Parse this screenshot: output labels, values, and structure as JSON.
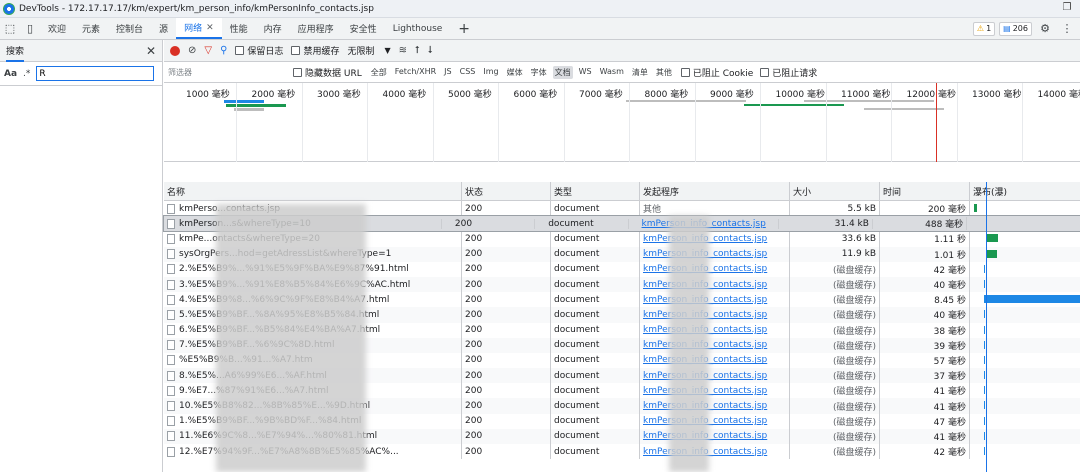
{
  "window": {
    "title": "DevTools - 172.17.17.17/km/expert/km_person_info/kmPersonInfo_contacts.jsp"
  },
  "tabs": [
    {
      "label": "欢迎"
    },
    {
      "label": "元素"
    },
    {
      "label": "控制台"
    },
    {
      "label": "源"
    },
    {
      "label": "网络",
      "active": true
    },
    {
      "label": "性能"
    },
    {
      "label": "内存"
    },
    {
      "label": "应用程序"
    },
    {
      "label": "安全性"
    },
    {
      "label": "Lighthouse"
    }
  ],
  "status_badges": {
    "warnings": "1",
    "issues": "206"
  },
  "sidebar": {
    "title": "搜索",
    "case_label": "Aa",
    "regex_label": ".*",
    "search_value": "R"
  },
  "toolbar": {
    "preserve_log": "保留日志",
    "disable_cache": "禁用缓存",
    "throttle": "无限制"
  },
  "filterbar": {
    "placeholder": "筛选器",
    "hide_data_urls": "隐藏数据 URL",
    "types": [
      "全部",
      "Fetch/XHR",
      "JS",
      "CSS",
      "Img",
      "媒体",
      "字体",
      "文档",
      "WS",
      "Wasm",
      "清单",
      "其他"
    ],
    "active_type": "文档",
    "blocked_cookies": "已阻止 Cookie",
    "blocked_requests": "已阻止请求"
  },
  "overview_ticks": [
    "1000 毫秒",
    "2000 毫秒",
    "3000 毫秒",
    "4000 毫秒",
    "5000 毫秒",
    "6000 毫秒",
    "7000 毫秒",
    "8000 毫秒",
    "9000 毫秒",
    "10000 毫秒",
    "11000 毫秒",
    "12000 毫秒",
    "13000 毫秒",
    "14000 毫秒"
  ],
  "columns": {
    "name": "名称",
    "status": "状态",
    "type": "类型",
    "initiator": "发起程序",
    "size": "大小",
    "time": "时间",
    "waterfall": "瀑布(瀑)"
  },
  "rows": [
    {
      "name": "kmPerso...contacts.jsp",
      "status": "200",
      "type": "document",
      "initiator": "其他",
      "size": "5.5 kB",
      "time": "200 毫秒"
    },
    {
      "name": "kmPerson...s&whereType=10",
      "status": "200",
      "type": "document",
      "initiator": "kmPerson_info_contacts.jsp",
      "size": "31.4 kB",
      "time": "488 毫秒"
    },
    {
      "name": "kmPe...ontacts&whereType=20",
      "status": "200",
      "type": "document",
      "initiator": "kmPerson_info_contacts.jsp",
      "size": "33.6 kB",
      "time": "1.11 秒"
    },
    {
      "name": "sysOrgPers...hod=getAdressList&whereType=1",
      "status": "200",
      "type": "document",
      "initiator": "kmPerson_info_contacts.jsp",
      "size": "11.9 kB",
      "time": "1.01 秒"
    },
    {
      "name": "2.%E5%B9%...%91%E5%9F%BA%E9%87%91.html",
      "status": "200",
      "type": "document",
      "initiator": "kmPerson_info_contacts.jsp",
      "size": "(磁盘缓存)",
      "time": "42 毫秒"
    },
    {
      "name": "3.%E5%B9%...%91%E8%B5%84%E6%9C%AC.html",
      "status": "200",
      "type": "document",
      "initiator": "kmPerson_info_contacts.jsp",
      "size": "(磁盘缓存)",
      "time": "40 毫秒"
    },
    {
      "name": "4.%E5%B9%8...%6%9C%9F%E8%B4%A7.html",
      "status": "200",
      "type": "document",
      "initiator": "kmPerson_info_contacts.jsp",
      "size": "(磁盘缓存)",
      "time": "8.45 秒"
    },
    {
      "name": "5.%E5%B9%BF...%8A%95%E8%B5%84.html",
      "status": "200",
      "type": "document",
      "initiator": "kmPerson_info_contacts.jsp",
      "size": "(磁盘缓存)",
      "time": "40 毫秒"
    },
    {
      "name": "6.%E5%B9%BF...%B5%84%E4%BA%A7.html",
      "status": "200",
      "type": "document",
      "initiator": "kmPerson_info_contacts.jsp",
      "size": "(磁盘缓存)",
      "time": "38 毫秒"
    },
    {
      "name": "7.%E5%B9%BF...%6%9C%8D.html",
      "status": "200",
      "type": "document",
      "initiator": "kmPerson_info_contacts.jsp",
      "size": "(磁盘缓存)",
      "time": "39 毫秒"
    },
    {
      "name": "%E5%B9%B...%91...%A7.htm",
      "status": "200",
      "type": "document",
      "initiator": "kmPerson_info_contacts.jsp",
      "size": "(磁盘缓存)",
      "time": "57 毫秒"
    },
    {
      "name": "8.%E5%...A6%99%E6...%AF.html",
      "status": "200",
      "type": "document",
      "initiator": "kmPerson_info_contacts.jsp",
      "size": "(磁盘缓存)",
      "time": "37 毫秒"
    },
    {
      "name": "9.%E7...%87%91%E6...%A7.html",
      "status": "200",
      "type": "document",
      "initiator": "kmPerson_info_contacts.jsp",
      "size": "(磁盘缓存)",
      "time": "41 毫秒"
    },
    {
      "name": "10.%E5%B8%82...%8B%85%E...%9D.html",
      "status": "200",
      "type": "document",
      "initiator": "kmPerson_info_contacts.jsp",
      "size": "(磁盘缓存)",
      "time": "41 毫秒"
    },
    {
      "name": "1.%E5%B9%BF...%9B%BD%F...%84.html",
      "status": "200",
      "type": "document",
      "initiator": "kmPerson_info_contacts.jsp",
      "size": "(磁盘缓存)",
      "time": "47 毫秒"
    },
    {
      "name": "11.%E6%9C%8...%E7%94%...%80%81.html",
      "status": "200",
      "type": "document",
      "initiator": "kmPerson_info_contacts.jsp",
      "size": "(磁盘缓存)",
      "time": "41 毫秒"
    },
    {
      "name": "12.%E7%94%9F...%E7%A8%8B%E5%85%AC%...",
      "status": "200",
      "type": "document",
      "initiator": "kmPerson_info_contacts.jsp",
      "size": "(磁盘缓存)",
      "time": "42 毫秒"
    }
  ]
}
